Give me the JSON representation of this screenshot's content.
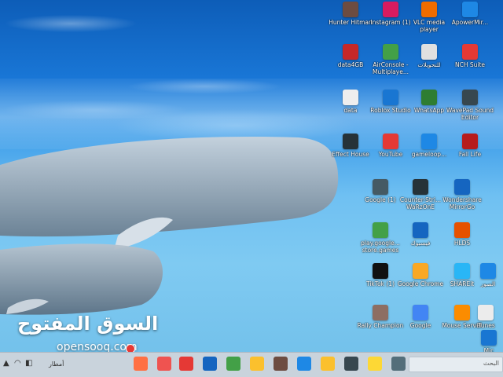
{
  "watermark": {
    "arabic": "السوق المفتوح",
    "latin": "opensooq.com"
  },
  "desktop_icons": [
    {
      "label": "Hunter Hitman",
      "icon": "game-icon",
      "color": "#6d4c41"
    },
    {
      "label": "Instagram (1)",
      "icon": "instagram-icon",
      "color": "#d81b60"
    },
    {
      "label": "VLC media player",
      "icon": "vlc-icon",
      "color": "#ef6c00"
    },
    {
      "label": "ApowerMir...",
      "icon": "app-icon",
      "color": "#1e88e5"
    },
    {
      "label": "data4GB",
      "icon": "folder-icon",
      "color": "#c62828"
    },
    {
      "label": "AirConsole - Multiplaye...",
      "icon": "airconsole-icon",
      "color": "#43a047"
    },
    {
      "label": "للتحويلات",
      "icon": "file-icon",
      "color": "#e0e0e0"
    },
    {
      "label": "NCH Suite",
      "icon": "nch-icon",
      "color": "#e53935"
    },
    {
      "label": "data",
      "icon": "file-icon",
      "color": "#eeeeee"
    },
    {
      "label": "Roblox Studio",
      "icon": "roblox-icon",
      "color": "#1976d2"
    },
    {
      "label": "WhatsApp",
      "icon": "whatsapp-icon",
      "color": "#2e7d32"
    },
    {
      "label": "WavePad Sound Editor",
      "icon": "wavepad-icon",
      "color": "#37474f"
    },
    {
      "label": "Effect House",
      "icon": "effect-house-icon",
      "color": "#263238"
    },
    {
      "label": "YouTube",
      "icon": "youtube-icon",
      "color": "#e53935"
    },
    {
      "label": "gameloop...",
      "icon": "gameloop-icon",
      "color": "#1e88e5"
    },
    {
      "label": "Fall Life",
      "icon": "game-icon",
      "color": "#b71c1c"
    },
    {
      "label": "Google (1)",
      "icon": "google-icon",
      "color": "#455a64"
    },
    {
      "label": "Counter-Stri... WaRzOnE",
      "icon": "counter-strike-icon",
      "color": "#263238"
    },
    {
      "label": "Wondershare MirrorGo",
      "icon": "mirrorgo-icon",
      "color": "#1565c0"
    },
    {
      "label": "play.google... store.games",
      "icon": "play-games-icon",
      "color": "#43a047"
    },
    {
      "label": "فيسبوك",
      "icon": "facebook-icon",
      "color": "#1565c0"
    },
    {
      "label": "HLDS",
      "icon": "hlds-icon",
      "color": "#e65100"
    },
    {
      "label": "TikTok (1)",
      "icon": "tiktok-icon",
      "color": "#111111"
    },
    {
      "label": "Google Chrome",
      "icon": "chrome-icon",
      "color": "#f9a825"
    },
    {
      "label": "SHAREit",
      "icon": "shareit-icon",
      "color": "#29b6f6"
    },
    {
      "label": "الصور",
      "icon": "photos-icon",
      "color": "#1e88e5"
    },
    {
      "label": "Rally Champion",
      "icon": "game-icon",
      "color": "#8d6e63"
    },
    {
      "label": "Google",
      "icon": "google-icon",
      "color": "#4285f4"
    },
    {
      "label": "Mouse Server",
      "icon": "mouse-server-icon",
      "color": "#fb8c00"
    },
    {
      "label": "iTunes",
      "icon": "itunes-icon",
      "color": "#ececec"
    },
    {
      "label": "Mic",
      "icon": "microsoft-icon",
      "color": "#1976d2"
    }
  ],
  "taskbar": {
    "weather_text": "أمطار",
    "search_text": "البحث",
    "pinned": [
      {
        "icon": "play-icon",
        "color": "#ff7043"
      },
      {
        "icon": "calendar-icon",
        "color": "#ef5350"
      },
      {
        "icon": "youtube-icon",
        "color": "#e53935"
      },
      {
        "icon": "facebook-icon",
        "color": "#1565c0"
      },
      {
        "icon": "chrome-icon",
        "color": "#43a047"
      },
      {
        "icon": "chrome-icon",
        "color": "#fbc02d"
      },
      {
        "icon": "store-icon",
        "color": "#6d4c41"
      },
      {
        "icon": "mail-icon",
        "color": "#1e88e5"
      },
      {
        "icon": "file-explorer-icon",
        "color": "#fbc02d"
      },
      {
        "icon": "steam-icon",
        "color": "#37474f"
      },
      {
        "icon": "folder-icon",
        "color": "#fdd835"
      },
      {
        "icon": "task-view-icon",
        "color": "#546e7a"
      }
    ]
  }
}
